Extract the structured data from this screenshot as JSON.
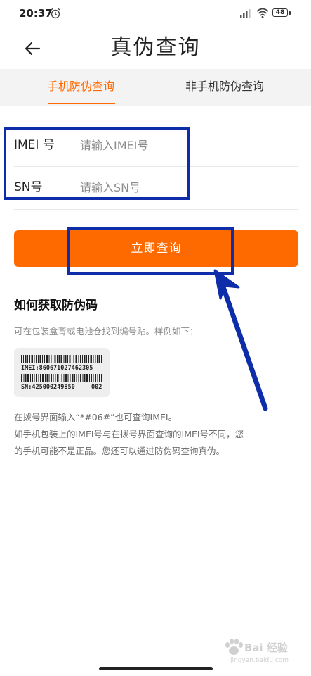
{
  "status_bar": {
    "time": "20:37",
    "battery": "48",
    "icons": [
      "alarm-icon",
      "signal-icon",
      "wifi-icon",
      "battery-icon"
    ]
  },
  "header": {
    "title": "真伪查询",
    "back_icon": "arrow-left-icon"
  },
  "tabs": [
    {
      "label": "手机防伪查询",
      "active": true
    },
    {
      "label": "非手机防伪查询",
      "active": false
    }
  ],
  "form": {
    "imei_label": "IMEI 号",
    "imei_placeholder": "请输入IMEI号",
    "sn_label": "SN号",
    "sn_placeholder": "请输入SN号"
  },
  "submit_label": "立即查询",
  "info": {
    "title": "如何获取防伪码",
    "description": "可在包装盒背或电池仓找到编号贴。样例如下：",
    "sample": {
      "imei": "IMEI:860671027462305",
      "sn": "SN:425000249850",
      "code": "002"
    },
    "notes": [
      "在拨号界面输入“*#06#”也可查询IMEI。",
      "如手机包装上的IMEI号与在拨号界面查询的IMEI号不同，您",
      "的手机可能不是正品。您还可以通过防伪码查询真伪。"
    ]
  },
  "watermark": {
    "text": "Bai 经验",
    "sub": "jingyan.baidu.com"
  },
  "colors": {
    "accent": "#ff6a00",
    "annotation": "#0d2ea8",
    "tab_bar": "#f3f3f3"
  }
}
